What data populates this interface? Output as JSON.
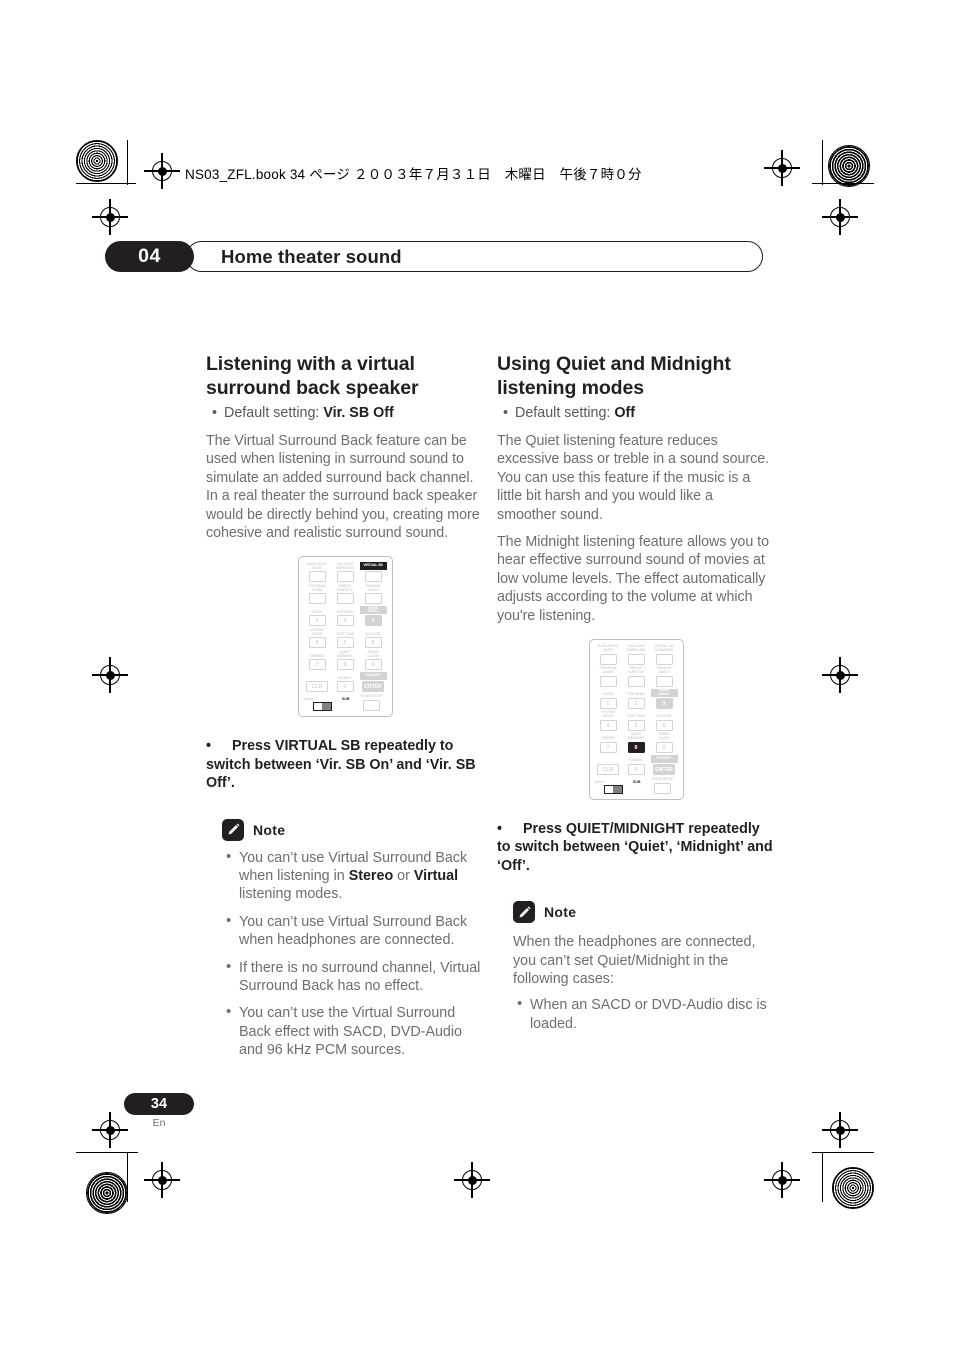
{
  "header": {
    "file_line": "NS03_ZFL.book  34 ページ  ２００３年７月３１日　木曜日　午後７時０分"
  },
  "chapter": {
    "number": "04",
    "title": "Home theater sound"
  },
  "left_column": {
    "section_title": "Listening with a virtual surround back speaker",
    "default_setting_prefix": "Default setting: ",
    "default_setting_value": "Vir. SB Off",
    "paragraphs": [
      "The Virtual Surround Back feature can be used when listening in surround sound to simulate an added surround back channel. In a real theater the surround back speaker would be directly behind you, creating more cohesive and realistic surround sound."
    ],
    "press_instruction": "Press VIRTUAL SB repeatedly to switch between ‘Vir. SB On’ and ‘Vir. SB Off’.",
    "note_label": "Note",
    "note_items": [
      {
        "pre": "You can’t use Virtual Surround Back when listening in ",
        "bold1": "Stereo",
        "mid": " or ",
        "bold2": "Virtual",
        "post": " listening modes."
      },
      {
        "pre": "You can’t use Virtual Surround Back when headphones are connected.",
        "bold1": "",
        "mid": "",
        "bold2": "",
        "post": ""
      },
      {
        "pre": "If there is no surround channel, Virtual Surround Back has no effect.",
        "bold1": "",
        "mid": "",
        "bold2": "",
        "post": ""
      },
      {
        "pre": "You can’t use the Virtual Surround Back effect with SACD, DVD-Audio and 96 kHz PCM sources.",
        "bold1": "",
        "mid": "",
        "bold2": "",
        "post": ""
      }
    ]
  },
  "right_column": {
    "section_title": "Using Quiet and Midnight listening modes",
    "default_setting_prefix": "Default setting: ",
    "default_setting_value": "Off",
    "paragraphs": [
      "The Quiet listening feature reduces excessive bass or treble in a sound source. You can use this feature if the music is a little bit harsh and you would like a smoother sound.",
      "The Midnight listening feature allows you to hear effective surround sound of movies at low volume levels. The effect automatically adjusts according to the volume at which you're listening."
    ],
    "press_instruction": "Press QUIET/MIDNIGHT repeatedly to switch between ‘Quiet’, ‘Midnight’ and ‘Off’.",
    "note_label": "Note",
    "note_text": "When the headphones are connected, you can’t set Quiet/Midnight in the following cases:",
    "note_items": [
      "When an SACD or DVD-Audio disc is loaded."
    ]
  },
  "remote_left": {
    "highlight": "VIRTUAL SB",
    "rows": [
      [
        {
          "label": "BASS MODE\nMUTE",
          "btn": "",
          "state": "normal"
        },
        {
          "label": "DIALOGUE\nSURROUND",
          "btn": "",
          "state": "normal"
        },
        {
          "label": "VIRTUAL SB",
          "btn": "",
          "state": "highlight"
        }
      ],
      [
        {
          "label": "PROGRAM\nAUDIO",
          "btn": "",
          "state": "normal"
        },
        {
          "label": "REPEAT\nSUBTITLE",
          "btn": "",
          "state": "normal"
        },
        {
          "label": "RANDOM\nANGLE",
          "btn": "",
          "state": "normal"
        }
      ],
      [
        {
          "label": "ZOOM",
          "btn": "1",
          "state": "normal"
        },
        {
          "label": "TOP MENU",
          "btn": "2",
          "state": "normal"
        },
        {
          "label": "HOME\nMENU",
          "btn": "3",
          "state": "grey"
        }
      ],
      [
        {
          "label": "SYSTEM\nSETUP",
          "btn": "4",
          "state": "normal"
        },
        {
          "label": "TEST TONE",
          "btn": "5",
          "state": "normal"
        },
        {
          "label": "CH LEVEL",
          "btn": "6",
          "state": "normal"
        }
      ],
      [
        {
          "label": "DIMMER",
          "btn": "7",
          "state": "normal"
        },
        {
          "label": "QUIET/\nMIDNIGHT",
          "btn": "8",
          "state": "normal"
        },
        {
          "label": "TIMER/\nCLOCK",
          "btn": "9",
          "state": "normal"
        }
      ],
      [
        {
          "label": "",
          "btn": "CLR",
          "state": "normal"
        },
        {
          "label": "FOLDER–",
          "btn": "0",
          "state": "normal"
        },
        {
          "label": "FOLDER+",
          "btn": "ENTER",
          "state": "grey"
        }
      ]
    ],
    "switch_main": "MAIN",
    "switch_sub": "SUB",
    "room_setup_label": "ROOM SETUP"
  },
  "remote_right": {
    "highlight": "QUIET/MIDNIGHT",
    "rows": [
      [
        {
          "label": "BASS MODE\nMUTE",
          "btn": "",
          "state": "normal"
        },
        {
          "label": "DIALOGUE\nSURROUND",
          "btn": "",
          "state": "normal"
        },
        {
          "label": "VIRTUAL SB\nADVANCED",
          "btn": "",
          "state": "normal"
        }
      ],
      [
        {
          "label": "PROGRAM\nAUDIO",
          "btn": "",
          "state": "normal"
        },
        {
          "label": "REPEAT\nSUBTITLE",
          "btn": "",
          "state": "normal"
        },
        {
          "label": "RANDOM\nANGLE",
          "btn": "",
          "state": "normal"
        }
      ],
      [
        {
          "label": "ZOOM",
          "btn": "1",
          "state": "normal"
        },
        {
          "label": "TOP MENU",
          "btn": "2",
          "state": "normal"
        },
        {
          "label": "HOME\nMENU",
          "btn": "3",
          "state": "grey"
        }
      ],
      [
        {
          "label": "SYSTEM\nSETUP",
          "btn": "4",
          "state": "normal"
        },
        {
          "label": "TEST TONE",
          "btn": "5",
          "state": "normal"
        },
        {
          "label": "CH LEVEL",
          "btn": "6",
          "state": "normal"
        }
      ],
      [
        {
          "label": "DIMMER",
          "btn": "7",
          "state": "normal"
        },
        {
          "label": "QUIET/\nMIDNIGHT",
          "btn": "8",
          "state": "highlight"
        },
        {
          "label": "TIMER/\nCLOCK",
          "btn": "9",
          "state": "normal"
        }
      ],
      [
        {
          "label": "",
          "btn": "CLR",
          "state": "normal"
        },
        {
          "label": "FOLDER–",
          "btn": "0",
          "state": "normal"
        },
        {
          "label": "FOLDER+",
          "btn": "ENTER",
          "state": "grey"
        }
      ]
    ],
    "switch_main": "MAIN",
    "switch_sub": "SUB",
    "room_setup_label": "ROOM SETUP"
  },
  "footer": {
    "page_number": "34",
    "language": "En"
  },
  "colors": {
    "ink": "#231f20",
    "body_grey": "#6d6e71",
    "light_grey": "#d1d3d4"
  }
}
